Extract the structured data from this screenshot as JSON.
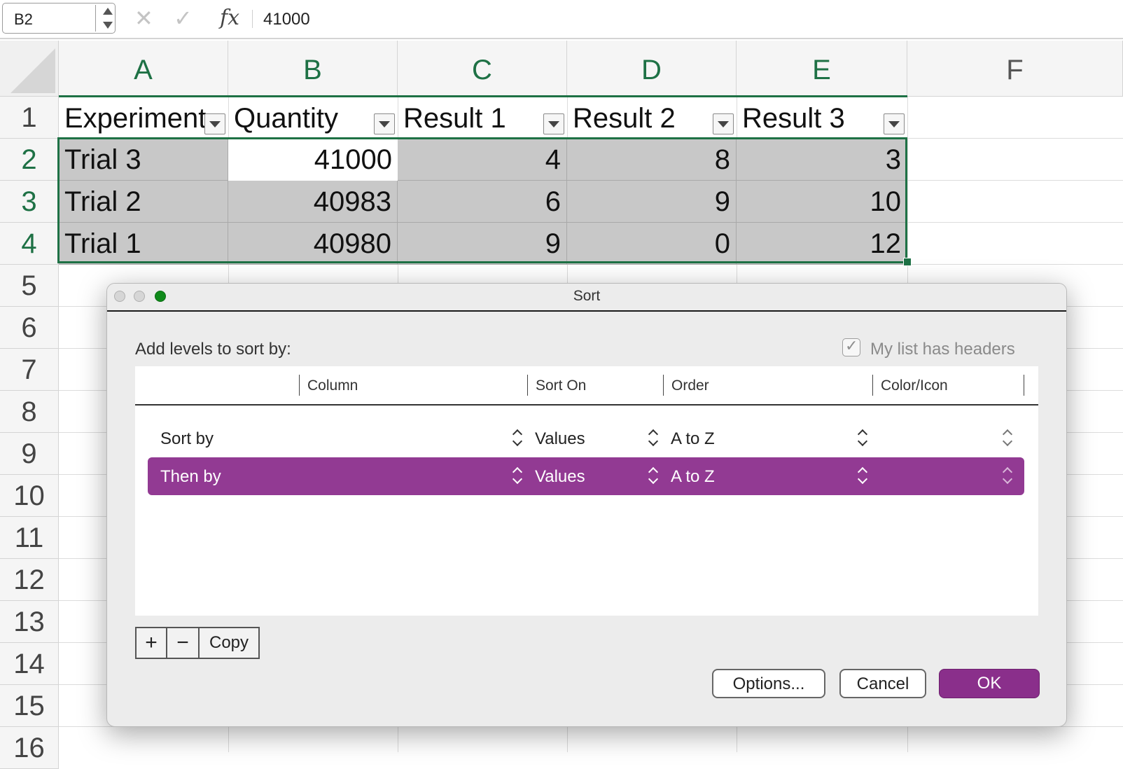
{
  "formula_bar": {
    "name_box": "B2",
    "cancel_icon": "✕",
    "enter_icon": "✓",
    "function_icon": "fx",
    "value": "41000"
  },
  "sheet": {
    "columns": [
      "A",
      "B",
      "C",
      "D",
      "E",
      "F"
    ],
    "rows": [
      "1",
      "2",
      "3",
      "4",
      "5",
      "6",
      "7",
      "8",
      "9",
      "10",
      "11",
      "12",
      "13",
      "14",
      "15",
      "16"
    ],
    "headers": [
      "Experiment",
      "Quantity",
      "Result 1",
      "Result 2",
      "Result 3"
    ],
    "data": [
      [
        "Trial 3",
        "41000",
        "4",
        "8",
        "3"
      ],
      [
        "Trial 2",
        "40983",
        "6",
        "9",
        "10"
      ],
      [
        "Trial 1",
        "40980",
        "9",
        "0",
        "12"
      ]
    ]
  },
  "dialog": {
    "title": "Sort",
    "levels_label": "Add levels to sort by:",
    "headers_label": "My list has headers",
    "headers_checked": true,
    "table_headers": [
      "Column",
      "Sort On",
      "Order",
      "Color/Icon"
    ],
    "rows": [
      {
        "label": "Sort by",
        "sort_on": "Values",
        "order": "A to Z"
      },
      {
        "label": "Then by",
        "sort_on": "Values",
        "order": "A to Z"
      }
    ],
    "add_symbol": "+",
    "remove_symbol": "−",
    "copy_label": "Copy",
    "options_label": "Options...",
    "cancel_label": "Cancel",
    "ok_label": "OK"
  },
  "colors": {
    "excel_green": "#1e7145",
    "accent_purple": "#923a93",
    "ok_purple": "#8a2f8b",
    "selection_gray": "#c8c8c8"
  }
}
